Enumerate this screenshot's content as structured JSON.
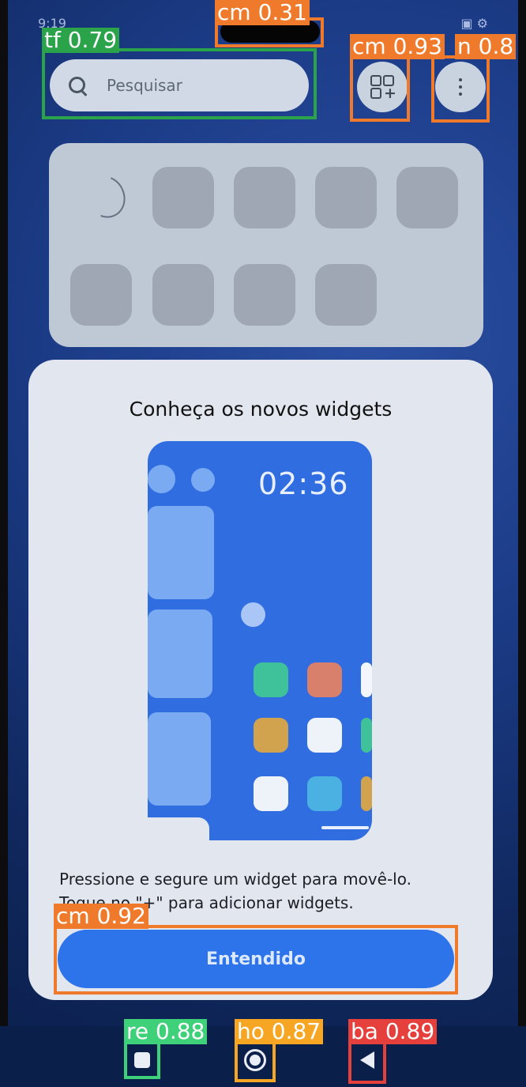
{
  "status_bar": {
    "time": "9:19",
    "icons": [
      "sim-icon",
      "notification-icon",
      "gear-icon",
      "battery-icon",
      "wifi-icon"
    ]
  },
  "search": {
    "placeholder": "Pesquisar",
    "icon": "search-icon"
  },
  "toolbar": {
    "add_widget_icon": "grid-plus-icon",
    "more_icon": "more-vert-icon"
  },
  "dialog": {
    "title": "Conheça os novos widgets",
    "illustration_time": "02:36",
    "message_line1": "Pressione e segure um widget para movê-lo.",
    "message_line2": "Toque no \"+\" para adicionar widgets.",
    "confirm_label": "Entendido"
  },
  "nav_bar": {
    "recent_icon": "square-icon",
    "home_icon": "home-circle-icon",
    "back_icon": "triangle-back-icon"
  },
  "detections": [
    {
      "label": "cm 0.31",
      "color": "#f07a2c"
    },
    {
      "label": "tf 0.79",
      "color": "#2aa34b"
    },
    {
      "label": "cm 0.93",
      "color": "#f07a2c"
    },
    {
      "label": "n 0.8",
      "color": "#f07a2c"
    },
    {
      "label": "cm 0.92",
      "color": "#f07a2c"
    },
    {
      "label": "re 0.88",
      "color": "#3fd07a"
    },
    {
      "label": "ho 0.87",
      "color": "#f6a623"
    },
    {
      "label": "ba 0.89",
      "color": "#e5403c"
    }
  ]
}
